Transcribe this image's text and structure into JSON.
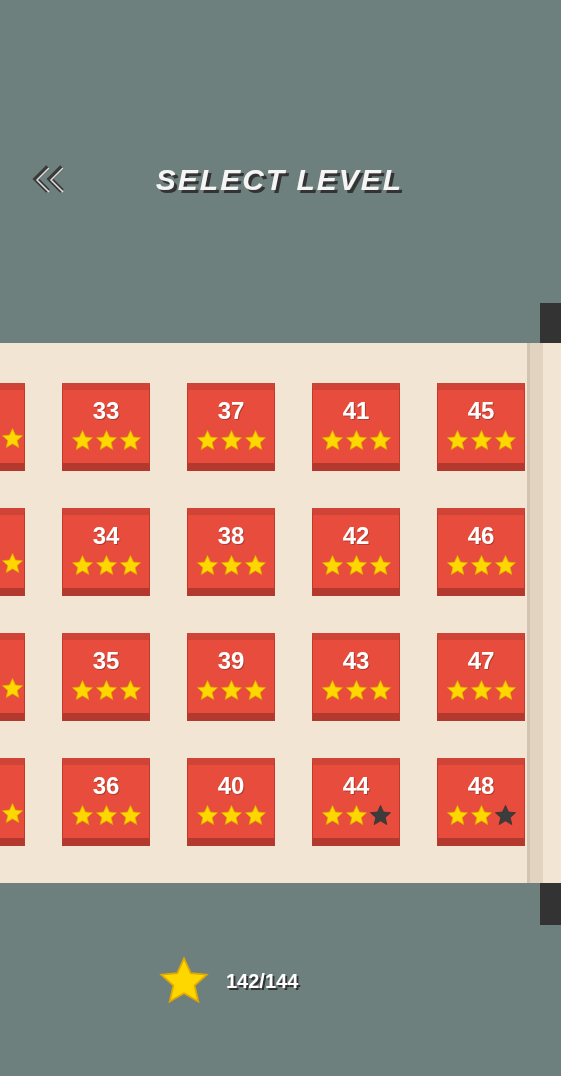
{
  "header": {
    "title": "SELECT LEVEL"
  },
  "rows": [
    {
      "tiles": [
        {
          "kind": "cut"
        },
        {
          "kind": "full",
          "label": "33",
          "stars": 3
        },
        {
          "kind": "full",
          "label": "37",
          "stars": 3
        },
        {
          "kind": "full",
          "label": "41",
          "stars": 3
        },
        {
          "kind": "full",
          "label": "45",
          "stars": 3
        }
      ]
    },
    {
      "tiles": [
        {
          "kind": "cut"
        },
        {
          "kind": "full",
          "label": "34",
          "stars": 3
        },
        {
          "kind": "full",
          "label": "38",
          "stars": 3
        },
        {
          "kind": "full",
          "label": "42",
          "stars": 3
        },
        {
          "kind": "full",
          "label": "46",
          "stars": 3
        }
      ]
    },
    {
      "tiles": [
        {
          "kind": "cut"
        },
        {
          "kind": "full",
          "label": "35",
          "stars": 3
        },
        {
          "kind": "full",
          "label": "39",
          "stars": 3
        },
        {
          "kind": "full",
          "label": "43",
          "stars": 3
        },
        {
          "kind": "full",
          "label": "47",
          "stars": 3
        }
      ]
    },
    {
      "tiles": [
        {
          "kind": "cut"
        },
        {
          "kind": "full",
          "label": "36",
          "stars": 3
        },
        {
          "kind": "full",
          "label": "40",
          "stars": 3
        },
        {
          "kind": "full",
          "label": "44",
          "stars": 2
        },
        {
          "kind": "full",
          "label": "48",
          "stars": 2
        }
      ]
    }
  ],
  "footer": {
    "total": "142/144"
  }
}
